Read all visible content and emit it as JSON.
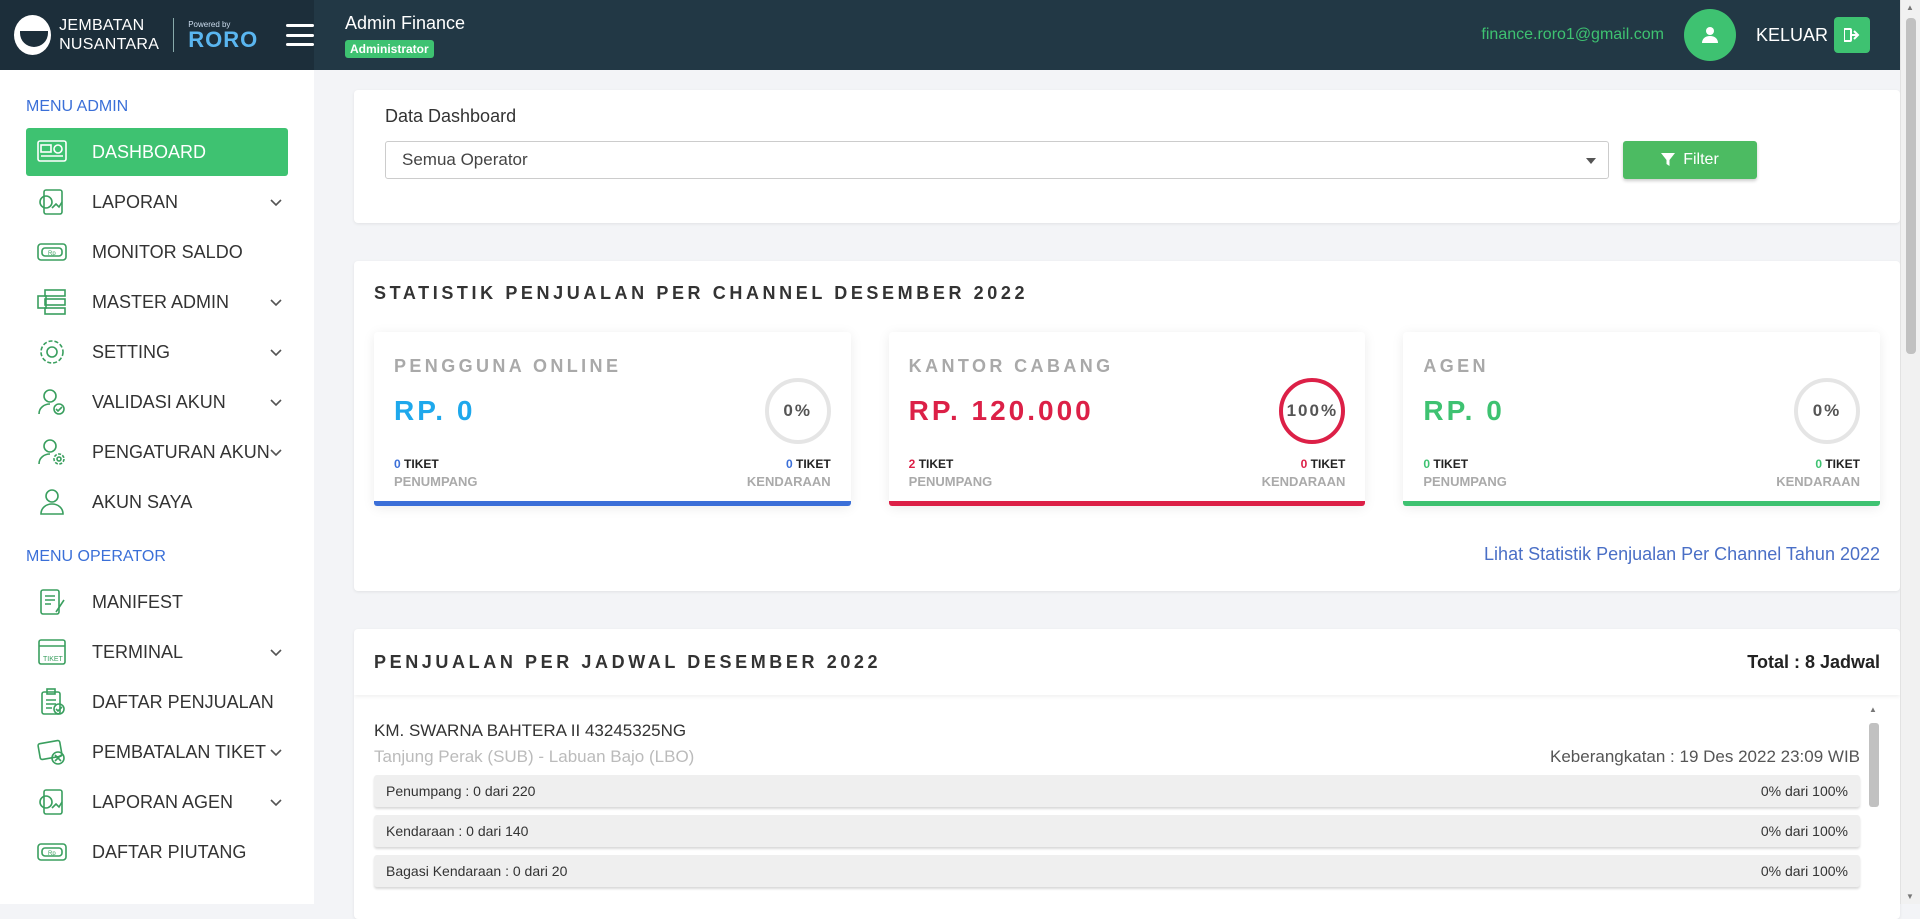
{
  "brand": {
    "line1": "JEMBATAN",
    "line2": "NUSANTARA",
    "powered_by": "Powered by",
    "product": "RORO"
  },
  "header": {
    "user_name": "Admin Finance",
    "role": "Administrator",
    "email": "finance.roro1@gmail.com",
    "logout_label": "KELUAR"
  },
  "sidebar": {
    "admin_title": "MENU ADMIN",
    "admin_items": [
      {
        "label": "DASHBOARD",
        "icon": "dashboard-icon",
        "active": true
      },
      {
        "label": "LAPORAN",
        "icon": "report-icon",
        "has_children": true
      },
      {
        "label": "MONITOR SALDO",
        "icon": "money-icon"
      },
      {
        "label": "MASTER ADMIN",
        "icon": "server-icon",
        "has_children": true
      },
      {
        "label": "SETTING",
        "icon": "gear-icon",
        "has_children": true
      },
      {
        "label": "VALIDASI AKUN",
        "icon": "user-check-icon",
        "has_children": true
      },
      {
        "label": "PENGATURAN AKUN",
        "icon": "user-gear-icon",
        "has_children": true
      },
      {
        "label": "AKUN SAYA",
        "icon": "user-icon"
      }
    ],
    "operator_title": "MENU OPERATOR",
    "operator_items": [
      {
        "label": "MANIFEST",
        "icon": "manifest-icon"
      },
      {
        "label": "TERMINAL",
        "icon": "ticket-icon",
        "has_children": true
      },
      {
        "label": "DAFTAR PENJUALAN",
        "icon": "clipboard-check-icon"
      },
      {
        "label": "PEMBATALAN TIKET",
        "icon": "ticket-cancel-icon",
        "has_children": true
      },
      {
        "label": "LAPORAN AGEN",
        "icon": "report-icon",
        "has_children": true
      },
      {
        "label": "DAFTAR PIUTANG",
        "icon": "money-icon"
      }
    ]
  },
  "filter": {
    "title": "Data Dashboard",
    "selected_operator": "Semua Operator",
    "button_label": "Filter"
  },
  "stats": {
    "title": "STATISTIK PENJUALAN PER CHANNEL DESEMBER 2022",
    "channels": [
      {
        "name": "PENGGUNA ONLINE",
        "amount": "RP. 0",
        "percent": "0%",
        "percent_value": 0,
        "passenger_count": "0",
        "passenger_label": "TIKET",
        "passenger_sub": "PENUMPANG",
        "vehicle_count": "0",
        "vehicle_label": "TIKET",
        "vehicle_sub": "KENDARAAN",
        "color": "#3b6fd8",
        "amount_color": "#1ea8ec"
      },
      {
        "name": "KANTOR CABANG",
        "amount": "RP. 120.000",
        "percent": "100%",
        "percent_value": 100,
        "passenger_count": "2",
        "passenger_label": "TIKET",
        "passenger_sub": "PENUMPANG",
        "vehicle_count": "0",
        "vehicle_label": "TIKET",
        "vehicle_sub": "KENDARAAN",
        "color": "#dc2047",
        "amount_color": "#dc2047"
      },
      {
        "name": "AGEN",
        "amount": "RP. 0",
        "percent": "0%",
        "percent_value": 0,
        "passenger_count": "0",
        "passenger_label": "TIKET",
        "passenger_sub": "PENUMPANG",
        "vehicle_count": "0",
        "vehicle_label": "TIKET",
        "vehicle_sub": "KENDARAAN",
        "color": "#3ec271",
        "amount_color": "#3ec271"
      }
    ],
    "link": "Lihat Statistik Penjualan Per Channel Tahun 2022"
  },
  "schedule": {
    "title": "PENJUALAN PER JADWAL DESEMBER 2022",
    "total": "Total : 8 Jadwal",
    "ship": "KM. SWARNA BAHTERA II 43245325NG",
    "route": "Tanjung Perak (SUB) - Labuan Bajo (LBO)",
    "departure": "Keberangkatan : 19 Des 2022 23:09 WIB",
    "capacities": [
      {
        "label": "Penumpang : 0 dari 220",
        "percent": "0% dari 100%"
      },
      {
        "label": "Kendaraan : 0 dari 140",
        "percent": "0% dari 100%"
      },
      {
        "label": "Bagasi Kendaraan : 0 dari 20",
        "percent": "0% dari 100%"
      }
    ]
  }
}
